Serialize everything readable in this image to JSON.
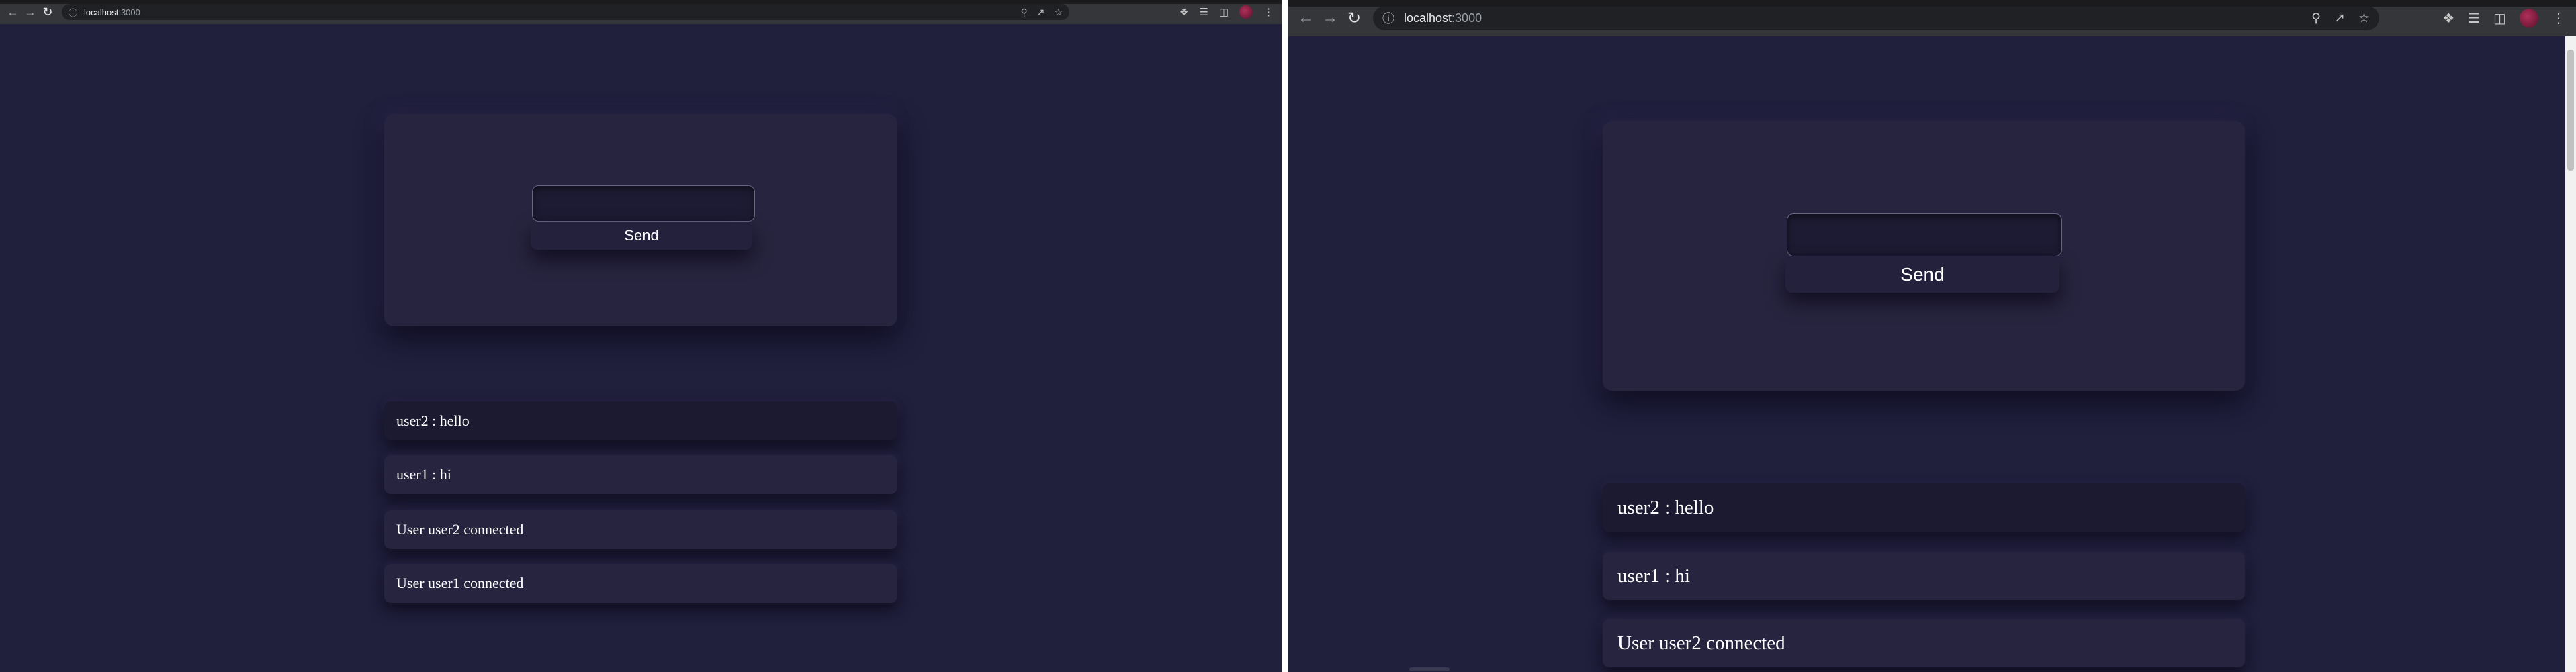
{
  "colors": {
    "page_bg": "#201f3c",
    "panel": "#27243f",
    "text": "#ffffff",
    "chrome": "#35363a"
  },
  "left_window": {
    "url_host": "localhost",
    "url_port": ":3000",
    "send_label": "Send",
    "input_value": "",
    "messages": [
      "user2 : hello",
      "user1 : hi",
      "User user2 connected",
      "User user1 connected"
    ]
  },
  "right_window": {
    "url_host": "localhost",
    "url_port": ":3000",
    "send_label": "Send",
    "input_value": "",
    "messages": [
      "user2 : hello",
      "user1 : hi",
      "User user2 connected"
    ]
  },
  "icons": [
    "back-icon",
    "forward-icon",
    "reload-icon",
    "info-icon",
    "zoom-icon",
    "share-icon",
    "star-icon",
    "extensions-icon",
    "media-icon",
    "sidepanel-icon",
    "profile-avatar",
    "menu-icon"
  ]
}
